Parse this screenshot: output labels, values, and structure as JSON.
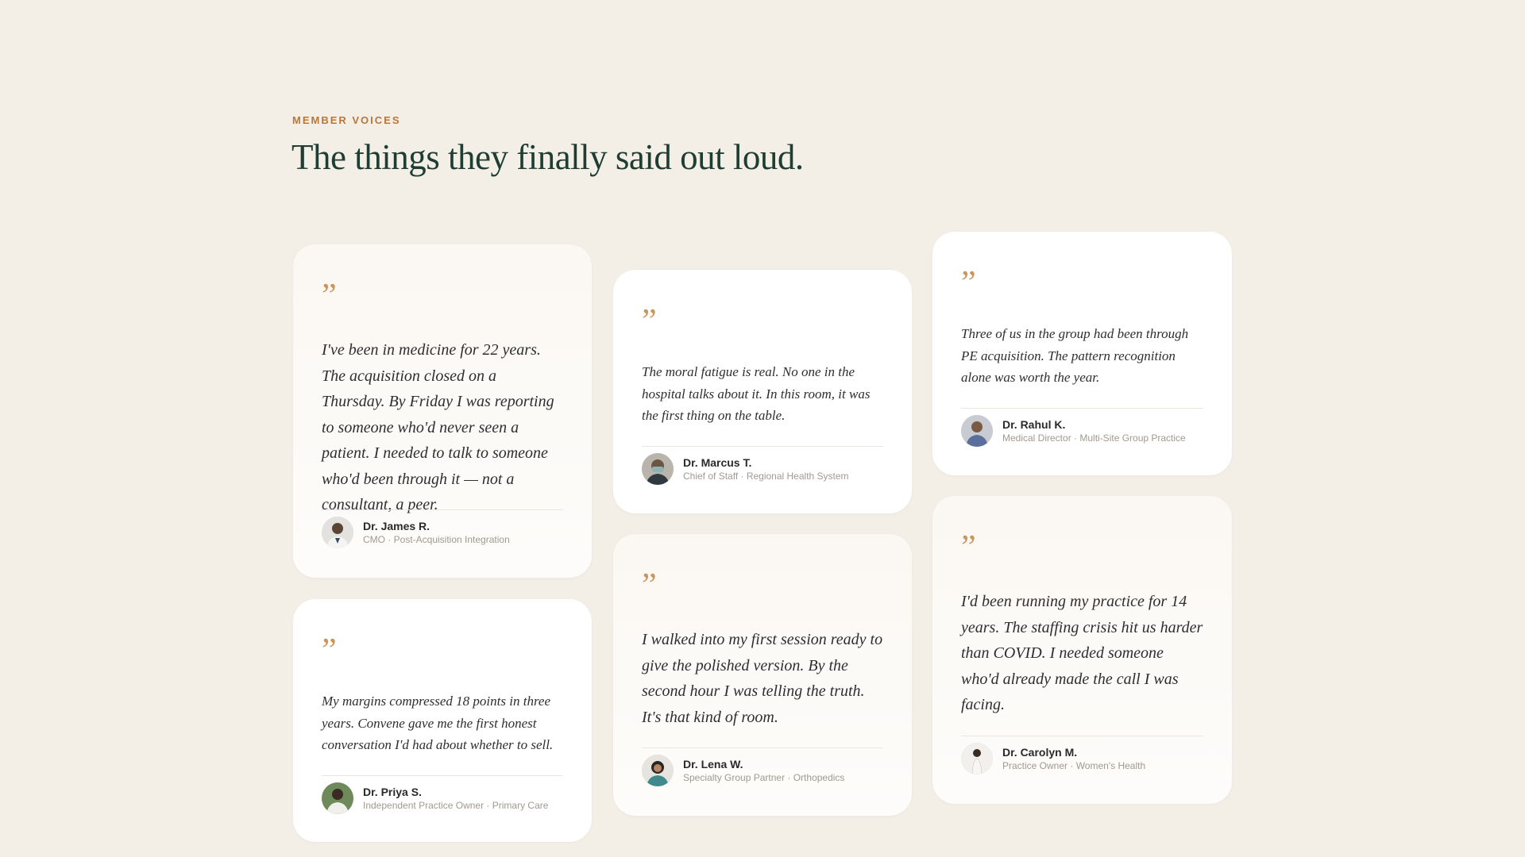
{
  "section": {
    "eyebrow": "MEMBER VOICES",
    "headline": "The things they finally said out loud."
  },
  "quote_glyph": "”",
  "testimonials": [
    {
      "quote": "I've been in medicine for 22 years. The acquisition closed on a Thursday. By Friday I was reporting to someone who'd never seen a patient. I needed to talk to someone who'd been through it — not a consultant, a peer.",
      "name": "Dr. James R.",
      "role": "CMO · Post-Acquisition Integration"
    },
    {
      "quote": "The moral fatigue is real. No one in the hospital talks about it. In this room, it was the first thing on the table.",
      "name": "Dr. Marcus T.",
      "role": "Chief of Staff · Regional Health System"
    },
    {
      "quote": "Three of us in the group had been through PE acquisition. The pattern recognition alone was worth the year.",
      "name": "Dr. Rahul K.",
      "role": "Medical Director · Multi-Site Group Practice"
    },
    {
      "quote": "My margins compressed 18 points in three years. Convene gave me the first honest conversation I'd had about whether to sell.",
      "name": "Dr. Priya S.",
      "role": "Independent Practice Owner · Primary Care"
    },
    {
      "quote": "I walked into my first session ready to give the polished version. By the second hour I was telling the truth. It's that kind of room.",
      "name": "Dr. Lena W.",
      "role": "Specialty Group Partner · Orthopedics"
    },
    {
      "quote": "I'd been running my practice for 14 years. The staffing crisis hit us harder than COVID. I needed someone who'd already made the call I was facing.",
      "name": "Dr. Carolyn M.",
      "role": "Practice Owner · Women's Health"
    }
  ],
  "colors": {
    "background": "#f3efe7",
    "accent": "#b8773a",
    "quote_mark": "#c9955c",
    "headline": "#1f3d33"
  }
}
